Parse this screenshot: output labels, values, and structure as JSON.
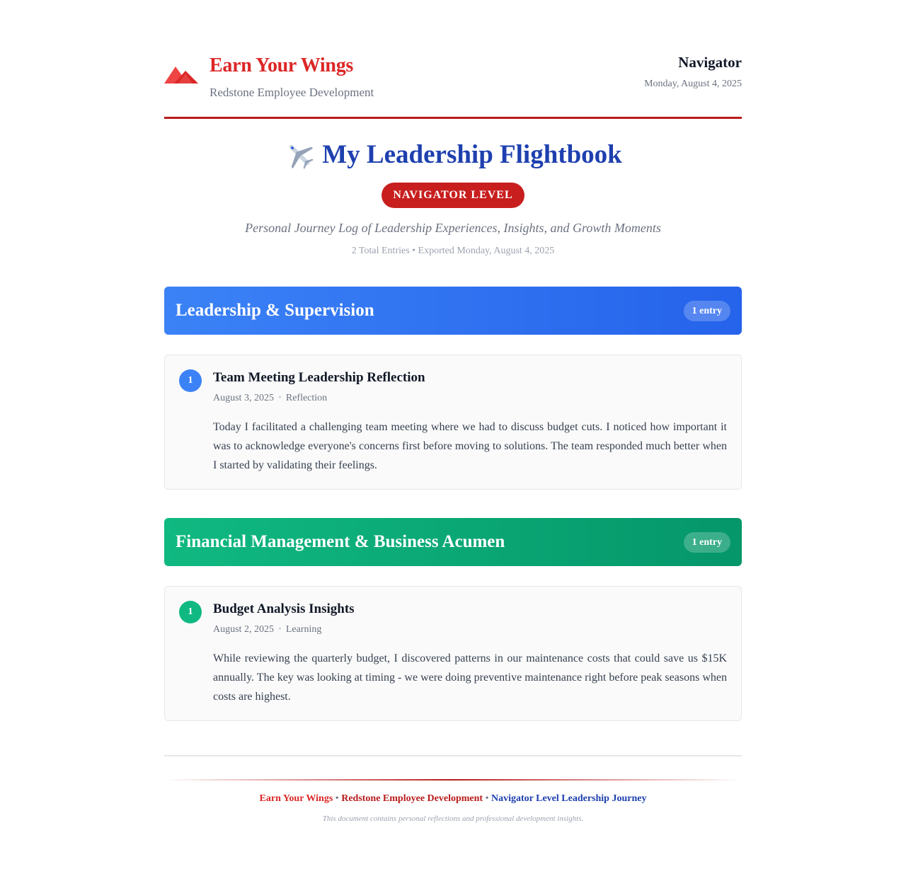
{
  "header": {
    "brand_title": "Earn Your Wings",
    "brand_subtitle": "Redstone Employee Development",
    "level": "Navigator",
    "date": "Monday, August 4, 2025",
    "logo_icon": "mountain-logo-icon"
  },
  "document": {
    "title": "My Leadership Flightbook",
    "title_icon": "airplane-icon",
    "level_badge": "NAVIGATOR LEVEL",
    "subtitle": "Personal Journey Log of Leadership Experiences, Insights, and Growth Moments",
    "summary": "2 Total Entries • Exported Monday, August 4, 2025"
  },
  "categories": [
    {
      "title": "Leadership & Supervision",
      "count": "1 entry",
      "color": "#3b82f6",
      "entries": [
        {
          "number": "1",
          "title": "Team Meeting Leadership Reflection",
          "date": "August 3, 2025",
          "type": "Reflection",
          "body": "Today I facilitated a challenging team meeting where we had to discuss budget cuts. I noticed how important it was to acknowledge everyone's concerns first before moving to solutions. The team responded much better when I started by validating their feelings."
        }
      ]
    },
    {
      "title": "Financial Management & Business Acumen",
      "count": "1 entry",
      "color": "#10b981",
      "entries": [
        {
          "number": "1",
          "title": "Budget Analysis Insights",
          "date": "August 2, 2025",
          "type": "Learning",
          "body": "While reviewing the quarterly budget, I discovered patterns in our maintenance costs that could save us $15K annually. The key was looking at timing - we were doing preventive maintenance right before peak seasons when costs are highest."
        }
      ]
    }
  ],
  "footer": {
    "brand": "Earn Your Wings",
    "separator": "•",
    "org": "Redstone Employee Development",
    "journey": "Navigator Level Leadership Journey",
    "note": "This document contains personal reflections and professional development insights."
  },
  "colors": {
    "brand_red": "#dc2626",
    "accent_blue": "#1e40af",
    "category_blue": "#3b82f6",
    "category_green": "#10b981"
  }
}
